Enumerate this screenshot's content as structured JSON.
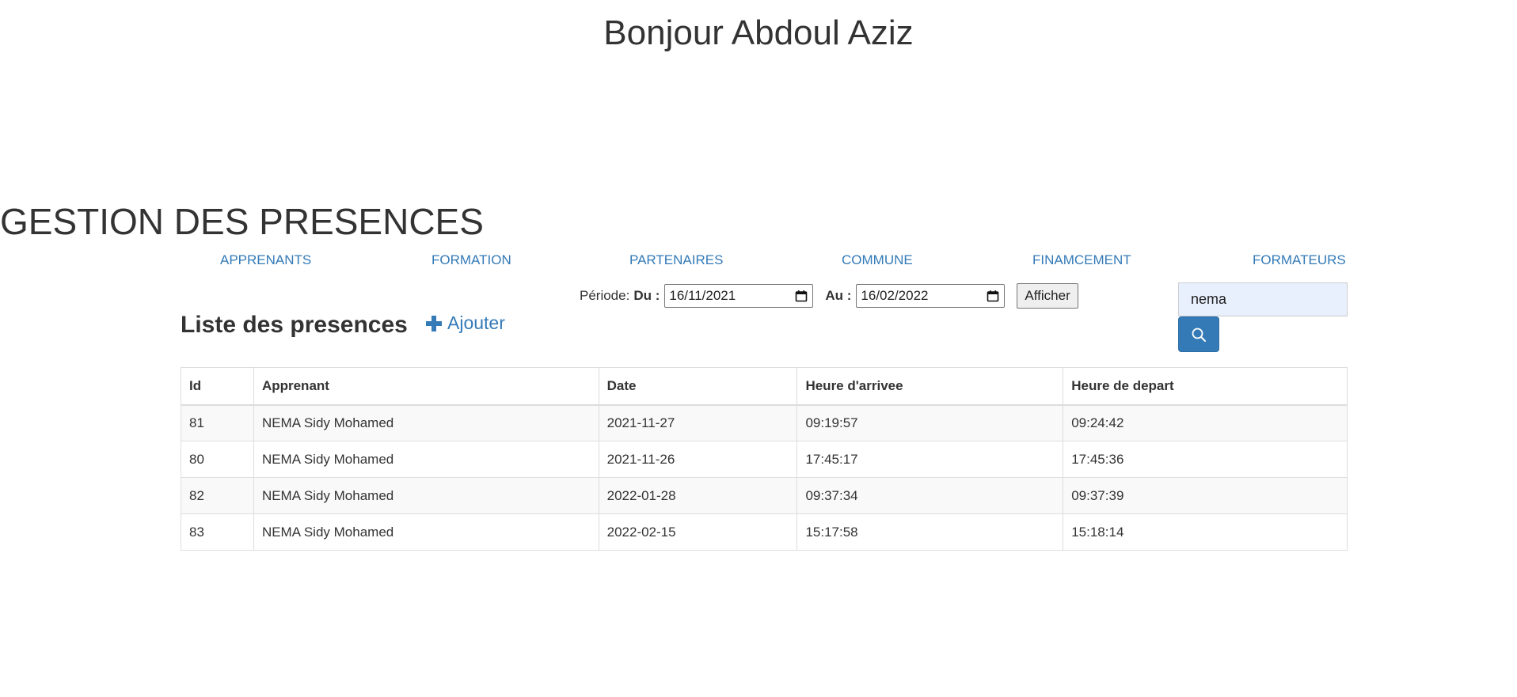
{
  "header": {
    "greeting": "Bonjour Abdoul Aziz"
  },
  "page": {
    "title": "GESTION DES PRESENCES"
  },
  "nav": {
    "items": [
      "APPRENANTS",
      "FORMATION",
      "PARTENAIRES",
      "COMMUNE",
      "FINAMCEMENT",
      "FORMATEURS"
    ]
  },
  "filter": {
    "period_label": "Période:",
    "du_label": "Du :",
    "du_value": "16/11/2021",
    "au_label": "Au :",
    "au_value": "16/02/2022",
    "submit_label": "Afficher",
    "calendar_icon": "calendar-icon"
  },
  "search": {
    "value": "nema",
    "button_icon": "search-icon"
  },
  "list": {
    "title": "Liste des presences",
    "add_label": "Ajouter",
    "add_icon": "plus-icon"
  },
  "table": {
    "columns": [
      "Id",
      "Apprenant",
      "Date",
      "Heure d'arrivee",
      "Heure de depart"
    ],
    "rows": [
      [
        "81",
        "NEMA Sidy Mohamed",
        "2021-11-27",
        "09:19:57",
        "09:24:42"
      ],
      [
        "80",
        "NEMA Sidy Mohamed",
        "2021-11-26",
        "17:45:17",
        "17:45:36"
      ],
      [
        "82",
        "NEMA Sidy Mohamed",
        "2022-01-28",
        "09:37:34",
        "09:37:39"
      ],
      [
        "83",
        "NEMA Sidy Mohamed",
        "2022-02-15",
        "15:17:58",
        "15:18:14"
      ]
    ]
  },
  "colors": {
    "link": "#337ab7",
    "text": "#333333",
    "autofill": "#e8f0fe",
    "stripe": "#f9f9f9",
    "border": "#dddddd"
  }
}
